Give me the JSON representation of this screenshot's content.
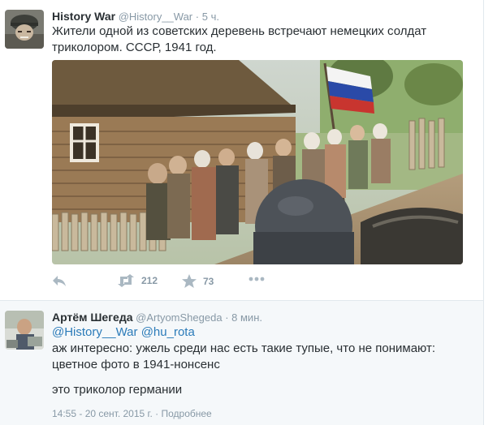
{
  "tweets": [
    {
      "author_name": "History War",
      "handle": "@History__War",
      "separator": "·",
      "time": "5 ч.",
      "text": "Жители одной из советских деревень встречают немецких солдат триколором. СССР, 1941 год.",
      "actions": {
        "retweets": "212",
        "favorites": "73"
      }
    },
    {
      "author_name": "Артём Шегеда",
      "handle": "@ArtyomShegeda",
      "separator": "·",
      "time": "8 мин.",
      "reply_mentions": [
        "@History__War",
        "@hu_rota"
      ],
      "text": "аж интересно: ужель среди нас есть такие тупые, что не понимают: цветное фото в 1941-нонсенс",
      "text_extra": "это триколор германии",
      "footer_date": "14:55 - 20 сент. 2015 г.",
      "footer_separator": "·",
      "footer_details": "Подробнее"
    }
  ],
  "icons": {
    "reply": "reply-icon",
    "retweet": "retweet-icon",
    "favorite": "star-icon",
    "more": "more-dots-icon",
    "flag": "tricolor-flag"
  },
  "colors": {
    "link": "#2b7bb9",
    "muted": "#8899a6",
    "flag_white": "#f4f4f4",
    "flag_blue": "#2a4aa8",
    "flag_red": "#c8352f"
  }
}
